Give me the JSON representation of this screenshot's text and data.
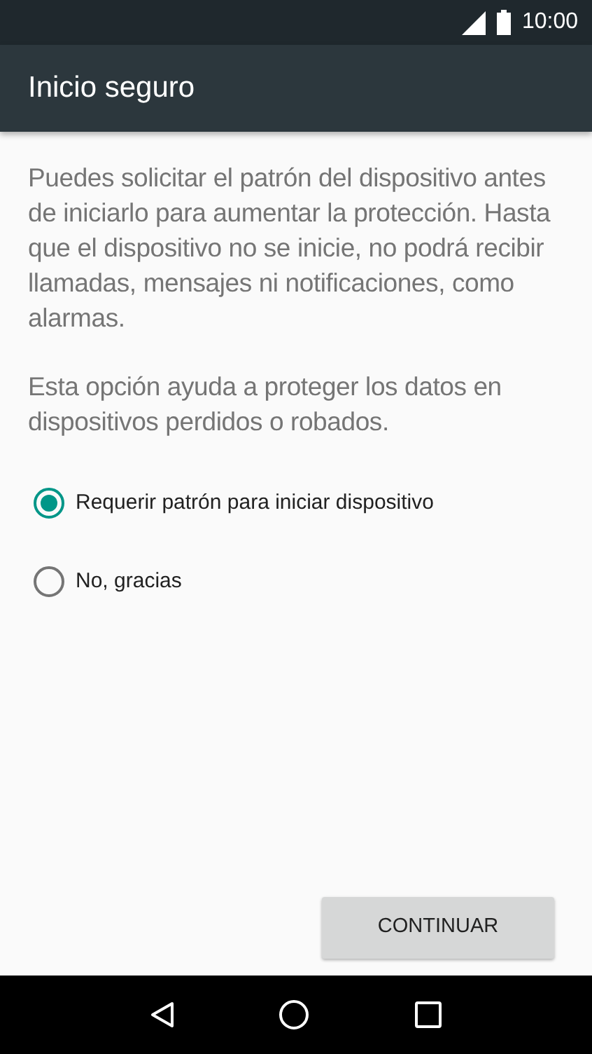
{
  "status_bar": {
    "time": "10:00"
  },
  "app_bar": {
    "title": "Inicio seguro"
  },
  "paragraphs": [
    "Puedes solicitar el patrón del dispositivo antes de iniciarlo para aumentar la protección. Hasta que el dispositivo no se inicie, no podrá recibir llamadas, mensajes ni notificaciones, como alarmas.",
    "Esta opción ayuda a proteger los datos en dispositivos perdidos o robados."
  ],
  "options": [
    {
      "label": "Requerir patrón para iniciar dispositivo",
      "selected": true
    },
    {
      "label": "No, gracias",
      "selected": false
    }
  ],
  "button": "CONTINUAR"
}
